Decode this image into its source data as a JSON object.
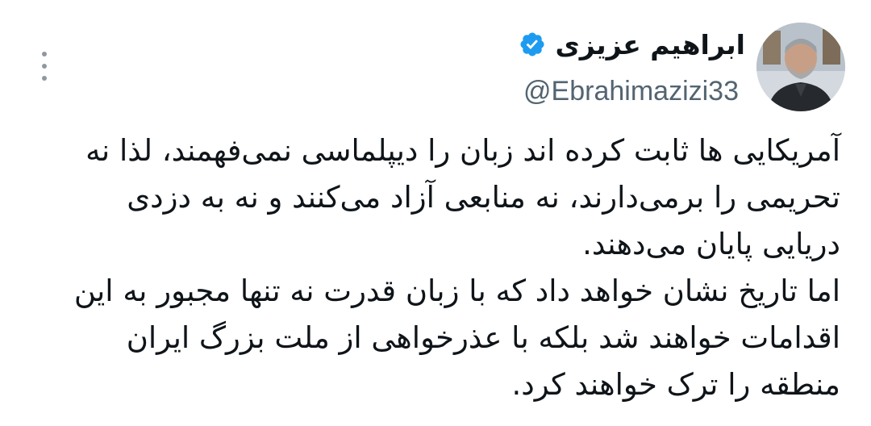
{
  "tweet": {
    "author": {
      "display_name": "ابراهیم عزیزی",
      "handle": "@Ebrahimazizi33",
      "verified_icon": "verified-badge-icon",
      "avatar_icon": "profile-photo"
    },
    "more_icon": "more-options-icon",
    "text_lines": [
      "آمریکایی ها ثابت کرده اند زبان را دیپلماسی نمی‌فهمند، لذا نه",
      "تحریمی را برمی‌دارند، نه منابعی آزاد می‌کنند و نه به دزدی",
      "دریایی پایان می‌دهند.",
      "اما تاریخ نشان خواهد داد که با زبان قدرت نه تنها مجبور به این",
      "اقدامات خواهند شد بلکه با عذرخواهی از ملت بزرگ ایران",
      "منطقه را ترک خواهند کرد."
    ]
  },
  "colors": {
    "text": "#0f1419",
    "secondary_text": "#536471",
    "verified_blue": "#1d9bf0",
    "dots": "#8f989f",
    "background": "#ffffff"
  }
}
